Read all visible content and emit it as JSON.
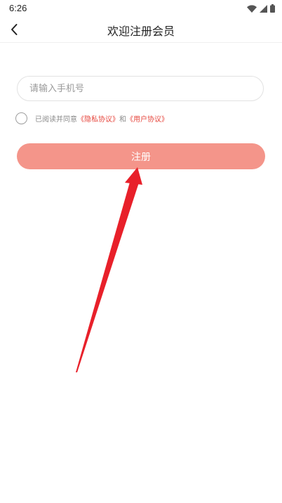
{
  "status_bar": {
    "time": "6:26",
    "icons": [
      "wifi-icon",
      "cellular-signal-icon",
      "battery-icon"
    ]
  },
  "header": {
    "back_icon": "chevron-left-icon",
    "title": "欢迎注册会员"
  },
  "form": {
    "phone_placeholder": "请输入手机号",
    "phone_value": ""
  },
  "agreement": {
    "prefix": "已阅读并同意",
    "privacy_link": "《隐私协议》",
    "conjunction": "和",
    "user_link": "《用户协议》",
    "checked": false
  },
  "register_button": {
    "label": "注册"
  },
  "colors": {
    "accent": "#e6463d",
    "button_bg": "#f4958a",
    "annotation_arrow": "#e8202a"
  }
}
